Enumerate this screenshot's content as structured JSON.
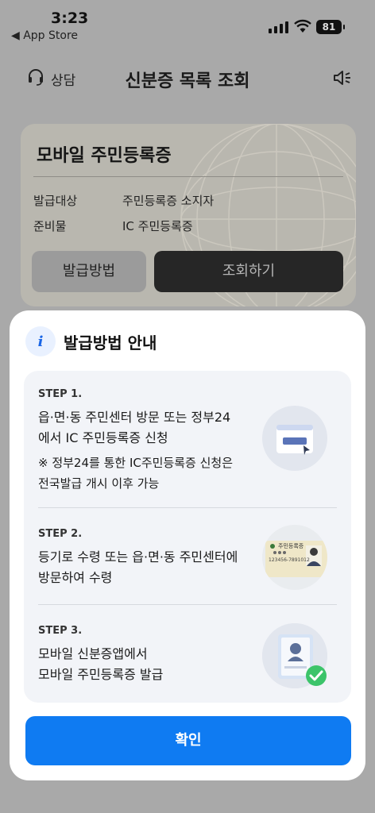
{
  "status_bar": {
    "time": "3:23",
    "back_app": "◀ App Store",
    "battery": "81"
  },
  "header": {
    "counsel_label": "상담",
    "title": "신분증 목록 조회"
  },
  "card": {
    "title": "모바일 주민등록증",
    "rows": [
      {
        "label": "발급대상",
        "value": "주민등록증 소지자"
      },
      {
        "label": "준비물",
        "value": "IC 주민등록증"
      }
    ],
    "method_button": "발급방법",
    "lookup_button": "조회하기"
  },
  "sheet": {
    "title": "발급방법 안내",
    "steps": [
      {
        "label": "STEP 1.",
        "line1": "읍·면·동 주민센터 방문 또는 정부24",
        "line2": "에서 IC 주민등록증 신청",
        "note1": "※ 정부24를 통한 IC주민등록증 신청은",
        "note2": "전국발급 개시 이후 가능"
      },
      {
        "label": "STEP 2.",
        "line1": "등기로 수령 또는 읍·면·동 주민센터에",
        "line2": "방문하여 수령"
      },
      {
        "label": "STEP 3.",
        "line1": "모바일 신분증앱에서",
        "line2": "모바일 주민등록증 발급"
      }
    ],
    "card_illustration_text": "주민등록증",
    "card_illustration_number": "123456-7891012",
    "confirm_button": "확인"
  },
  "colors": {
    "accent": "#0f7bf2",
    "check": "#3cc46a"
  }
}
